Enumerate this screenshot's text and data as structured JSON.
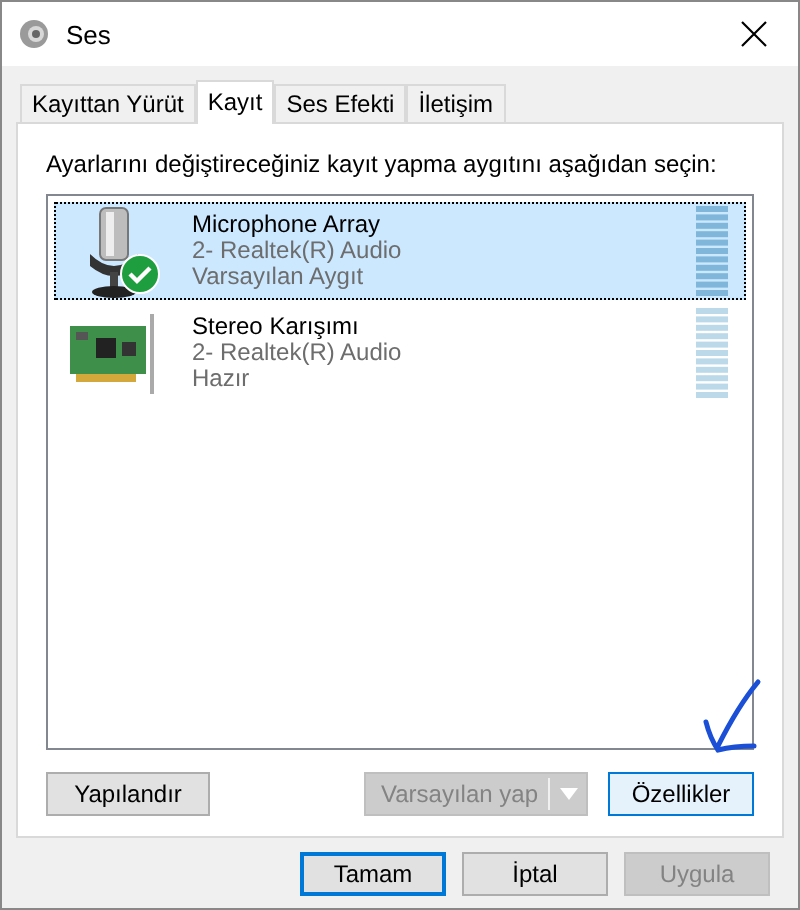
{
  "window": {
    "title": "Ses"
  },
  "tabs": [
    {
      "label": "Kayıttan Yürüt",
      "selected": false
    },
    {
      "label": "Kayıt",
      "selected": true
    },
    {
      "label": "Ses Efekti",
      "selected": false
    },
    {
      "label": "İletişim",
      "selected": false
    }
  ],
  "instruction": "Ayarlarını değiştireceğiniz kayıt yapma aygıtını aşağıdan seçin:",
  "devices": [
    {
      "kind": "microphone",
      "name": "Microphone Array",
      "driver": "2- Realtek(R) Audio",
      "status": "Varsayılan Aygıt",
      "selected": true,
      "is_default": true
    },
    {
      "kind": "sound-card",
      "name": "Stereo Karışımı",
      "driver": "2- Realtek(R) Audio",
      "status": "Hazır",
      "selected": false,
      "is_default": false
    }
  ],
  "panel_buttons": {
    "configure": {
      "label": "Yapılandır"
    },
    "set_default": {
      "label": "Varsayılan yap",
      "disabled": true
    },
    "properties": {
      "label": "Özellikler",
      "focused": true
    }
  },
  "dialog_buttons": [
    {
      "label": "Tamam",
      "default": true,
      "disabled": false
    },
    {
      "label": "İptal",
      "default": false,
      "disabled": false
    },
    {
      "label": "Uygula",
      "default": false,
      "disabled": true
    }
  ]
}
